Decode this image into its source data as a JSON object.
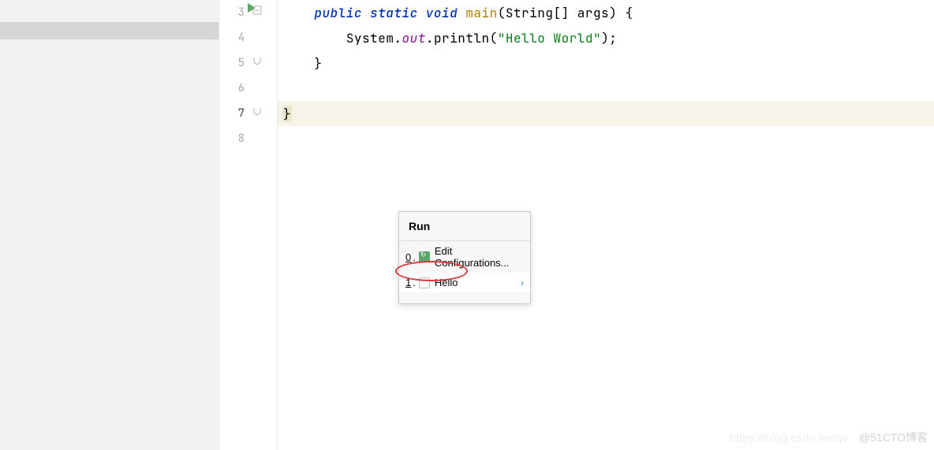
{
  "gutter": [
    "3",
    "4",
    "5",
    "6",
    "7",
    "8"
  ],
  "gutter_current_index": 4,
  "code": {
    "l0": {
      "indent": "    ",
      "kw": "public static void ",
      "fn": "main",
      "rest1": "(",
      "type": "String",
      "rest2": "[] args) {"
    },
    "l1": {
      "indent": "        ",
      "cls": "System",
      "dot1": ".",
      "field": "out",
      "dot2": ".",
      "m": "println",
      "paren_l": "(",
      "str": "\"Hello World\"",
      "paren_r": ")",
      "semi": ";"
    },
    "l2": {
      "indent": "    ",
      "brace": "}"
    },
    "l3": {
      "text": ""
    },
    "l4": {
      "brace": "}"
    },
    "l5": {
      "text": ""
    }
  },
  "popup": {
    "title": "Run",
    "items": [
      {
        "idx": "0",
        "label": "Edit Configurations..."
      },
      {
        "idx": "1",
        "label": "Hello"
      }
    ]
  },
  "watermark1": "https://blog.csdn.net/w",
  "watermark2": "@51CTO博客"
}
